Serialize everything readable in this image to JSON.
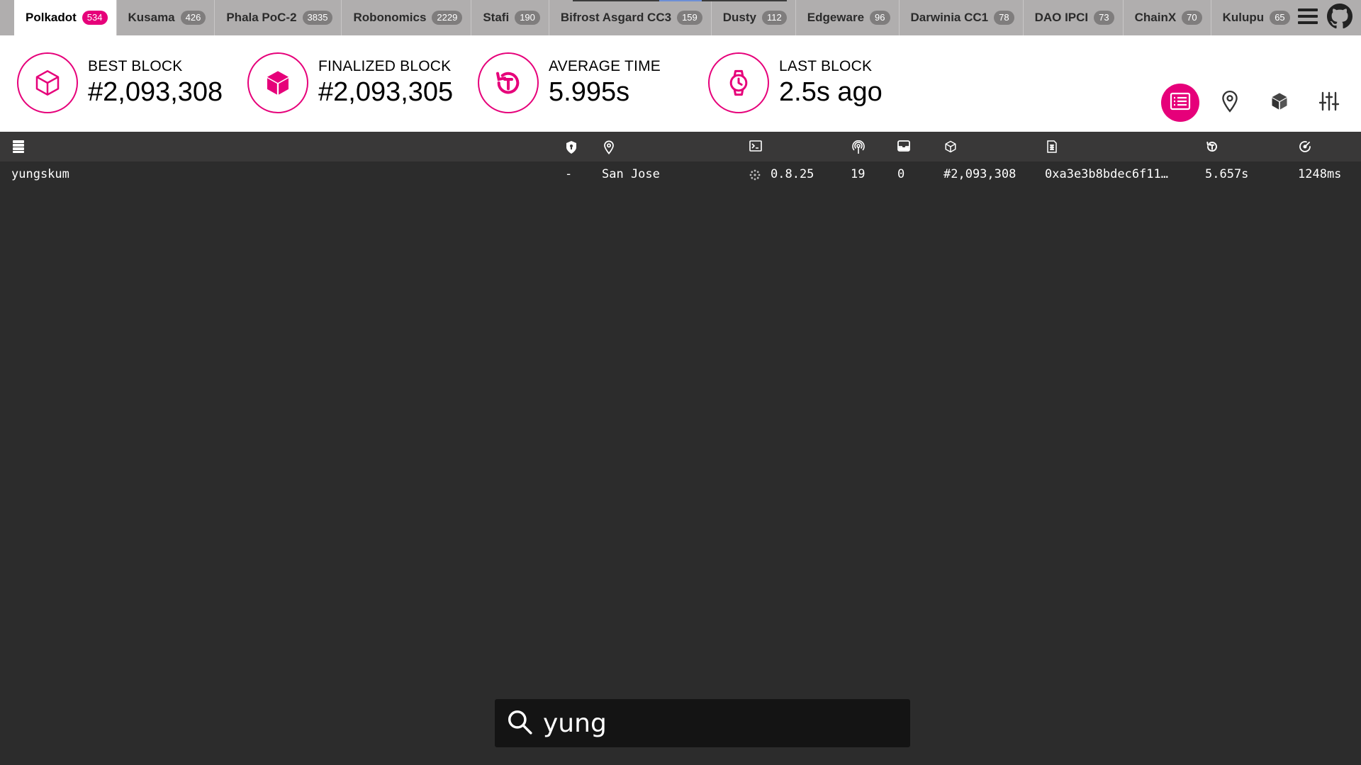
{
  "tabs": [
    {
      "label": "Polkadot",
      "count": "534"
    },
    {
      "label": "Kusama",
      "count": "426"
    },
    {
      "label": "Phala PoC-2",
      "count": "3835"
    },
    {
      "label": "Robonomics",
      "count": "2229"
    },
    {
      "label": "Stafi",
      "count": "190"
    },
    {
      "label": "Bifrost Asgard CC3",
      "count": "159"
    },
    {
      "label": "Dusty",
      "count": "112"
    },
    {
      "label": "Edgeware",
      "count": "96"
    },
    {
      "label": "Darwinia CC1",
      "count": "78"
    },
    {
      "label": "DAO IPCI",
      "count": "73"
    },
    {
      "label": "ChainX",
      "count": "70"
    },
    {
      "label": "Kulupu",
      "count": "65"
    }
  ],
  "tab_tools": {
    "menu_icon": "hamburger-menu-icon",
    "github_icon": "github-icon"
  },
  "stats": {
    "best_block": {
      "label": "BEST BLOCK",
      "value": "#2,093,308",
      "icon": "cube-outline-icon"
    },
    "finalized_block": {
      "label": "FINALIZED BLOCK",
      "value": "#2,093,305",
      "icon": "cube-solid-icon"
    },
    "average_time": {
      "label": "AVERAGE TIME",
      "value": "5.995s",
      "icon": "history-icon"
    },
    "last_block": {
      "label": "LAST BLOCK",
      "value": "2.5s ago",
      "icon": "watch-icon"
    }
  },
  "views": [
    "list-view-icon",
    "map-view-icon",
    "consensus-cube-icon",
    "settings-sliders-icon"
  ],
  "table": {
    "column_icons": [
      "node-name-icon",
      "validator-shield-icon",
      "location-pin-icon",
      "implementation-terminal-icon",
      "peers-icon",
      "transactions-inbox-icon",
      "block-cube-icon",
      "block-hash-icon",
      "block-time-icon",
      "propagation-icon"
    ],
    "rows": [
      {
        "name": "yungskum",
        "validator": "-",
        "location": "San Jose",
        "version": "0.8.25",
        "peers": "19",
        "txs": "0",
        "block": "#2,093,308",
        "hash": "0xa3e3b8bdec6f11…",
        "block_time": "5.657s",
        "propagation": "1248ms"
      }
    ]
  },
  "search": {
    "value": "yung",
    "icon": "search-icon"
  },
  "colors": {
    "accent": "#e6007a",
    "tab_bar": "#b0aeae",
    "table_bg": "#2c2c2c",
    "table_header": "#393838"
  }
}
